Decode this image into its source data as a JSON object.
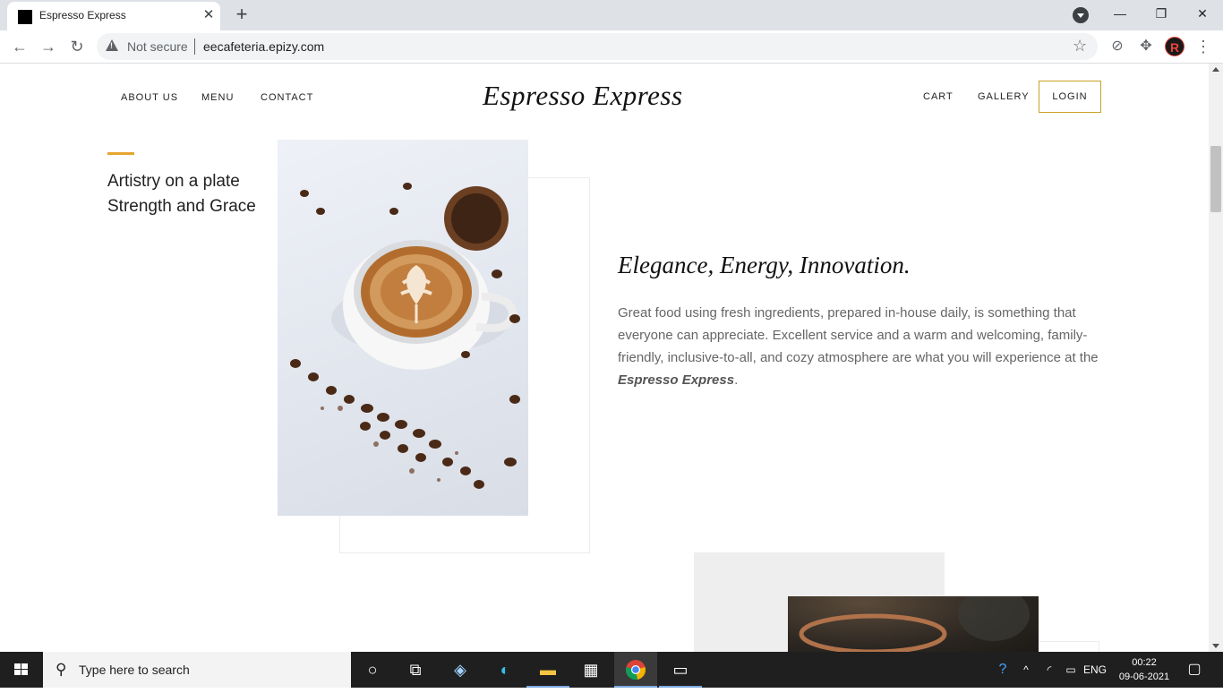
{
  "browser": {
    "tab_title": "Espresso Express",
    "tab_close": "✕",
    "new_tab": "+",
    "security_label": "Not secure",
    "url": "eecafeteria.epizy.com",
    "profile_initial": "R",
    "window_buttons": {
      "minimize": "—",
      "restore": "❐",
      "close": "✕"
    }
  },
  "site": {
    "logo": "Espresso Express",
    "nav_left": [
      "ABOUT US",
      "MENU",
      "CONTACT"
    ],
    "nav_right": [
      "CART",
      "GALLERY"
    ],
    "login_label": "LOGIN",
    "accent_color": "#e6a532",
    "login_border_color": "#c9a227",
    "tagline_line1": "Artistry on a plate",
    "tagline_line2": "Strength and Grace",
    "heading": "Elegance, Energy, Innovation.",
    "paragraph": "Great food using fresh ingredients, prepared in-house daily, is something that everyone can appreciate. Excellent service and a warm and welcoming, family-friendly, inclusive-to-all, and cozy atmosphere are what you will experience at the",
    "paragraph_emphasis": "Espresso Express",
    "paragraph_end": "."
  },
  "taskbar": {
    "search_placeholder": "Type here to search",
    "language": "ENG",
    "time": "00:22",
    "date": "09-06-2021"
  }
}
